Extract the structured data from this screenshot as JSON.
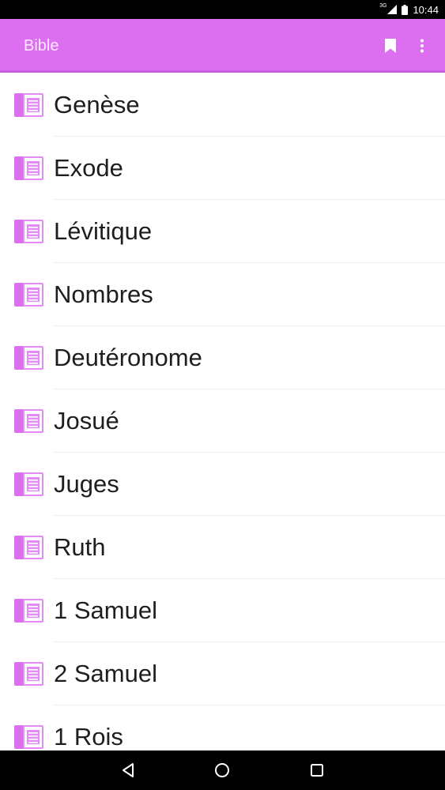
{
  "status_bar": {
    "network_label": "3G",
    "time": "10:44"
  },
  "app_bar": {
    "title": "Bible",
    "background_color": "#dc6ef0",
    "actions": [
      "bookmark-icon",
      "overflow-menu-icon"
    ]
  },
  "books": [
    {
      "label": "Genèse"
    },
    {
      "label": "Exode"
    },
    {
      "label": "Lévitique"
    },
    {
      "label": "Nombres"
    },
    {
      "label": "Deutéronome"
    },
    {
      "label": "Josué"
    },
    {
      "label": "Juges"
    },
    {
      "label": "Ruth"
    },
    {
      "label": "1 Samuel"
    },
    {
      "label": "2 Samuel"
    },
    {
      "label": "1 Rois"
    }
  ],
  "icons": {
    "book_item": "book-icon",
    "book_icon_color": "#dc6ef0"
  },
  "nav_bar": [
    "back-icon",
    "home-icon",
    "recents-icon"
  ]
}
